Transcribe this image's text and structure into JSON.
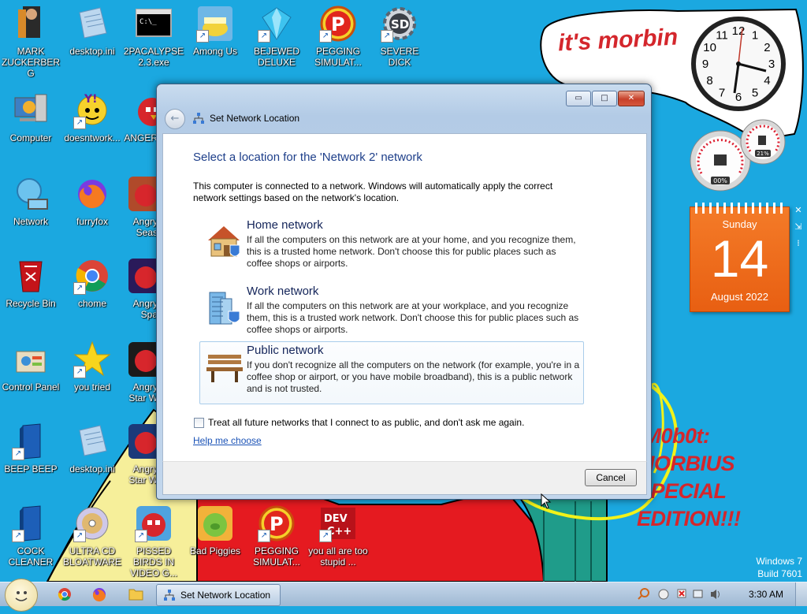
{
  "wallpaper": {
    "bubble_text": "it's morbin",
    "morbius_lines": [
      "fM0b0t:",
      "MORBIUS",
      "SPECIAL",
      "EDITION!!!"
    ],
    "windows_version": "Windows 7",
    "build": "Build 7601"
  },
  "desktop_icons": [
    {
      "label": "MARK ZUCKERBERG",
      "icon": "person-photo-icon"
    },
    {
      "label": "desktop.ini",
      "icon": "settings-file-icon"
    },
    {
      "label": "2PACALYPSE 2.3.exe",
      "icon": "console-app-icon"
    },
    {
      "label": "Among Us",
      "icon": "among-us-icon"
    },
    {
      "label": "BEJEWED DELUXE",
      "icon": "gem-icon"
    },
    {
      "label": "PEGGING SIMULAT...",
      "icon": "p-logo-icon"
    },
    {
      "label": "SEVERE DICK",
      "icon": "sd-gear-icon"
    },
    {
      "label": "Computer",
      "icon": "computer-icon"
    },
    {
      "label": "doesntwork...",
      "icon": "yahoo-messenger-icon"
    },
    {
      "label": "ANGER",
      "icon": "angry-bird-icon"
    },
    {
      "label": "Network",
      "icon": "network-globe-icon"
    },
    {
      "label": "furryfox",
      "icon": "firefox-icon"
    },
    {
      "label": "Angry Seas",
      "icon": "angry-birds-seasons-icon"
    },
    {
      "label": "Recycle Bin",
      "icon": "recycle-bin-icon"
    },
    {
      "label": "chome",
      "icon": "chrome-icon"
    },
    {
      "label": "Angry Spa",
      "icon": "angry-birds-space-icon"
    },
    {
      "label": "Control Panel",
      "icon": "control-panel-icon"
    },
    {
      "label": "you tried",
      "icon": "gold-star-icon"
    },
    {
      "label": "Angry Star W",
      "icon": "angry-birds-star-wars-icon"
    },
    {
      "label": "BEEP BEEP",
      "icon": "blue-book-icon"
    },
    {
      "label": "desktop.ini",
      "icon": "settings-file-icon"
    },
    {
      "label": "Angry Star W",
      "icon": "angry-birds-star-wars-icon"
    },
    {
      "label": "COCK CLEANER",
      "icon": "blue-book-icon"
    },
    {
      "label": "ULTRA CD BLOATWARE",
      "icon": "cd-disc-icon"
    },
    {
      "label": "PISSED BIRDS IN VIDEO G...",
      "icon": "angry-bird-icon"
    },
    {
      "label": "Bad Piggies",
      "icon": "bad-piggies-icon"
    },
    {
      "label": "PEGGING SIMULAT...",
      "icon": "p-logo-icon"
    },
    {
      "label": "you all are too stupid ...",
      "icon": "dev-cpp-icon"
    }
  ],
  "gadgets": {
    "clock_numbers": [
      "12",
      "1",
      "2",
      "3",
      "4",
      "5",
      "6",
      "7",
      "8",
      "9",
      "10",
      "11"
    ],
    "meter_cpu": "00%",
    "meter_ram": "21%",
    "calendar": {
      "weekday": "Sunday",
      "day": "14",
      "month_year": "August 2022"
    }
  },
  "dialog": {
    "title": "Set Network Location",
    "heading": "Select a location for the 'Network  2' network",
    "intro": "This computer is connected to a network. Windows will automatically apply the correct network settings based on the network's location.",
    "options": [
      {
        "title": "Home network",
        "icon": "home-network-icon",
        "description": "If all the computers on this network are at your home, and you recognize them, this is a trusted home network.  Don't choose this for public places such as coffee shops or airports.",
        "selected": false
      },
      {
        "title": "Work network",
        "icon": "work-network-icon",
        "description": "If all the computers on this network are at your workplace, and you recognize them, this is a trusted work network.  Don't choose this for public places such as coffee shops or airports.",
        "selected": false
      },
      {
        "title": "Public network",
        "icon": "public-bench-icon",
        "description": "If you don't recognize all the computers on the network (for example, you're in a coffee shop or airport, or you have mobile broadband), this is a public network and is not trusted.",
        "selected": true
      }
    ],
    "checkbox_label": "Treat all future networks that I connect to as public, and don't ask me again.",
    "checkbox_checked": false,
    "help_link": "Help me choose",
    "cancel_label": "Cancel",
    "controls": {
      "minimize": "▭",
      "maximize": "□",
      "close": "✕"
    },
    "back_glyph": "←"
  },
  "taskbar": {
    "pinned": [
      "chrome-icon",
      "firefox-icon",
      "folder-icon"
    ],
    "task_label": "Set Network Location",
    "time": "3:30 AM",
    "tray_icons": [
      "search-icon",
      "smiley-icon",
      "flag-icon",
      "network-icon",
      "volume-icon"
    ]
  }
}
